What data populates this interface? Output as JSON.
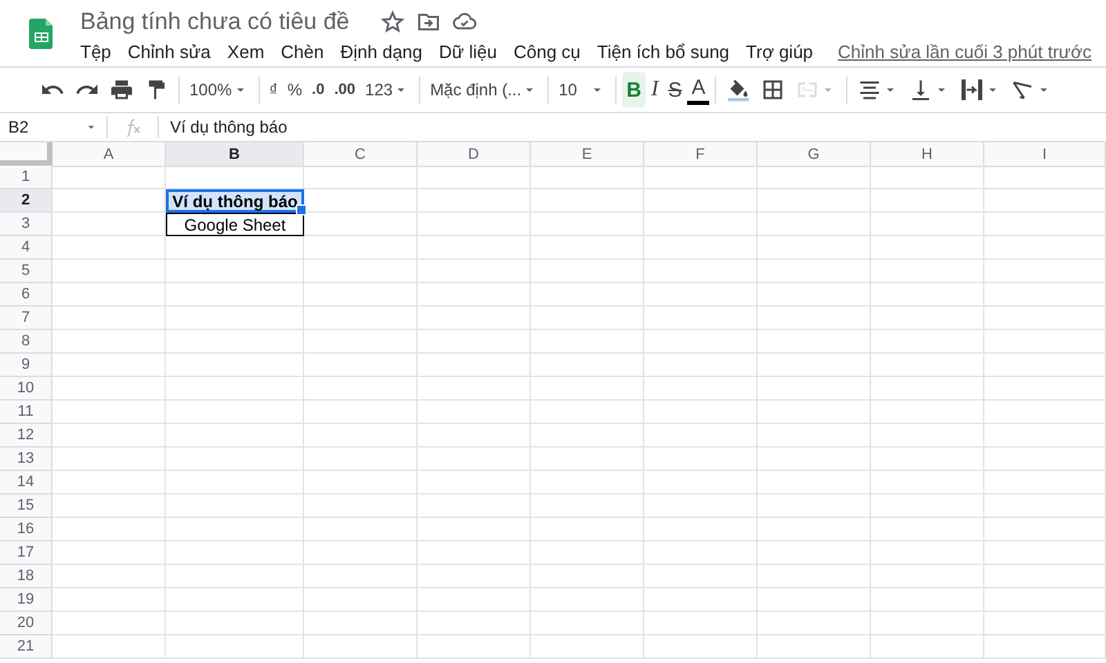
{
  "document": {
    "title": "Bảng tính chưa có tiêu đề",
    "last_edit": "Chỉnh sửa lần cuối 3 phút trước"
  },
  "menu": [
    "Tệp",
    "Chỉnh sửa",
    "Xem",
    "Chèn",
    "Định dạng",
    "Dữ liệu",
    "Công cụ",
    "Tiện ích bổ sung",
    "Trợ giúp"
  ],
  "toolbar": [
    [
      {
        "kind": "undo"
      },
      {
        "kind": "redo"
      },
      {
        "kind": "print"
      },
      {
        "kind": "paint"
      }
    ],
    [
      {
        "kind": "dropdown",
        "label": "100%"
      }
    ],
    [
      {
        "kind": "text",
        "label": "₫"
      },
      {
        "kind": "text",
        "label": "%"
      },
      {
        "kind": "decimal",
        "label": ".0"
      },
      {
        "kind": "decimal",
        "label": ".00"
      },
      {
        "kind": "menu",
        "label": "123"
      }
    ],
    [
      {
        "kind": "dropdown",
        "label": "Mặc định (..."
      }
    ],
    [
      {
        "kind": "dropdown",
        "label": "10"
      }
    ],
    [
      {
        "kind": "bold",
        "label": "B",
        "selected": true
      },
      {
        "kind": "italic",
        "label": "I",
        "selected": false
      },
      {
        "kind": "strike",
        "label": "S",
        "selected": false
      },
      {
        "kind": "textcolor",
        "label": "A"
      }
    ],
    [
      {
        "kind": "fill",
        "disabled": false
      },
      {
        "kind": "borders",
        "disabled": false
      },
      {
        "kind": "merge",
        "disabled": true
      }
    ],
    [
      {
        "kind": "halign"
      },
      {
        "kind": "valign"
      },
      {
        "kind": "wrap"
      },
      {
        "kind": "rotate"
      }
    ]
  ],
  "formula_bar": {
    "cell": "B2",
    "value": "Ví dụ thông báo"
  },
  "grid": {
    "columns": [
      "A",
      "B",
      "C",
      "D",
      "E",
      "F",
      "G",
      "H",
      "I"
    ],
    "rows": [
      {
        "label": "1"
      },
      {
        "label": "2",
        "cells": [
          {},
          {
            "text": "Ví dụ thông báo",
            "bold": true,
            "selected": true,
            "bordered": true
          }
        ]
      },
      {
        "label": "3",
        "cells": [
          {},
          {
            "text": "Google Sheet",
            "bold": false,
            "selected": false,
            "bordered": true
          }
        ]
      },
      {
        "label": "4"
      },
      {
        "label": "5"
      },
      {
        "label": "6"
      },
      {
        "label": "7"
      },
      {
        "label": "8"
      },
      {
        "label": "9"
      },
      {
        "label": "10"
      },
      {
        "label": "11"
      },
      {
        "label": "12"
      },
      {
        "label": "13"
      },
      {
        "label": "14"
      },
      {
        "label": "15"
      },
      {
        "label": "16"
      },
      {
        "label": "17"
      },
      {
        "label": "18"
      },
      {
        "label": "19"
      },
      {
        "label": "20"
      },
      {
        "label": "21"
      }
    ]
  }
}
